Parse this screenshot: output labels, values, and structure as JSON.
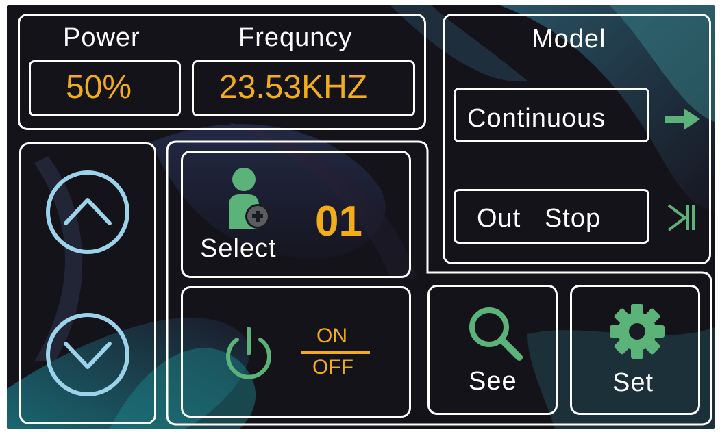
{
  "colors": {
    "accent": "#f2ad1a",
    "icon_green": "#5cb37a",
    "arrow_blue": "#9dd3ea",
    "border": "#ffffff",
    "background": "#14131a"
  },
  "status": {
    "power_label": "Power",
    "power_value": "50%",
    "frequency_label": "Frequncy",
    "frequency_value": "23.53KHZ"
  },
  "model": {
    "title": "Model",
    "mode_label": "Continuous",
    "mode_icon": "arrow-right-icon",
    "output_label": "Out   Stop",
    "output_icon": "skip-end-icon"
  },
  "nav": {
    "up_icon": "chevron-up-icon",
    "down_icon": "chevron-down-icon"
  },
  "select": {
    "label": "Select",
    "value": "01",
    "icon": "user-add-icon"
  },
  "power_toggle": {
    "on_label": "ON",
    "off_label": "OFF",
    "icon": "power-icon"
  },
  "buttons": {
    "see_label": "See",
    "see_icon": "search-icon",
    "set_label": "Set",
    "set_icon": "gear-icon"
  }
}
